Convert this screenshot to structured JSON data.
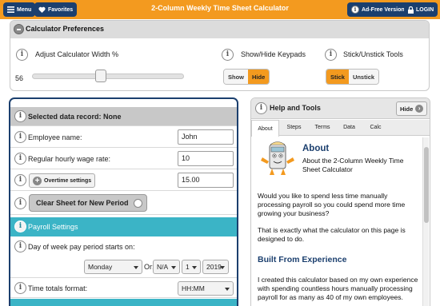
{
  "topbar": {
    "menu_label": "Menu",
    "favorites_label": "Favorites",
    "title": "2-Column Weekly Time Sheet Calculator",
    "adfree_label": "Ad-Free Version",
    "login_label": "LOGIN"
  },
  "prefs": {
    "title": "Calculator Preferences",
    "width_label": "Adjust Calculator Width %",
    "width_value": "56",
    "width_fraction": 0.56,
    "keypads_label": "Show/Hide Keypads",
    "keypads_show": "Show",
    "keypads_hide": "Hide",
    "keypads_selected": "Hide",
    "tools_label": "Stick/Unstick Tools",
    "tools_stick": "Stick",
    "tools_unstick": "Unstick",
    "tools_selected": "Stick"
  },
  "form": {
    "selected_record": "Selected data record: None",
    "employee_label": "Employee name:",
    "employee_value": "John",
    "wage_label": "Regular hourly wage rate:",
    "wage_value": "10",
    "overtime_button": "Overtime settings",
    "overtime_value": "15.00",
    "clear_button": "Clear Sheet for New Period",
    "payroll_section": "Payroll Settings",
    "week_start_label": "Day of week pay period starts on:",
    "day_select": "Monday",
    "or_label": "Or:",
    "month_select": "N/A",
    "date_select": "1",
    "year_select": "2019",
    "time_format_label": "Time totals format:",
    "time_format_value": "HH:MM"
  },
  "help": {
    "title": "Help and Tools",
    "hide_button": "Hide",
    "tabs": [
      "About",
      "Steps",
      "Terms",
      "Data",
      "Calc"
    ],
    "active_tab": "About",
    "about_heading": "About",
    "about_sub": "About the 2-Column Weekly Time Sheet Calculator",
    "p1": "Would you like to spend less time manually processing payroll so you could spend more time growing your business?",
    "p2": "That is exactly what the calculator on this page is designed to do.",
    "heading2": "Built From Experience",
    "p3": "I created this calculator based on my own experience with spending countless hours manually processing payroll for as many as 40 of my own employees."
  },
  "colors": {
    "brand_orange": "#f39a1f",
    "navy": "#1b3f6e",
    "teal": "#3bb4c6"
  }
}
